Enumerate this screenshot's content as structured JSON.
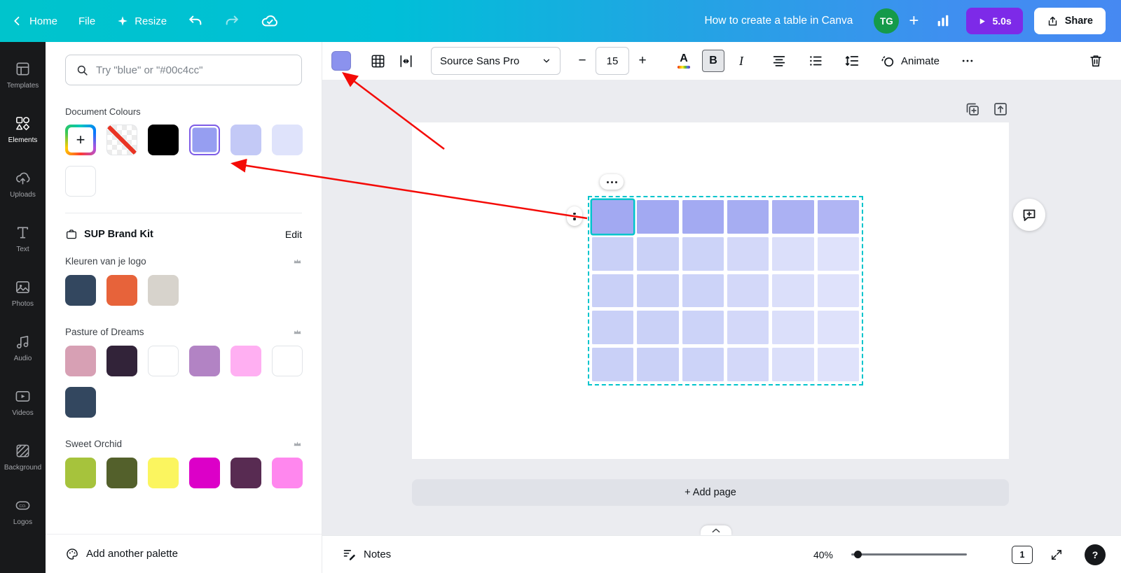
{
  "topbar": {
    "home_label": "Home",
    "file_label": "File",
    "resize_label": "Resize",
    "title": "How to create a table in Canva",
    "avatar_initials": "TG",
    "play_duration": "5.0s",
    "share_label": "Share",
    "play_color": "#7d2ae8",
    "avatar_color": "#159a4a"
  },
  "sidebar": {
    "items": [
      {
        "label": "Templates"
      },
      {
        "label": "Elements"
      },
      {
        "label": "Uploads"
      },
      {
        "label": "Text"
      },
      {
        "label": "Photos"
      },
      {
        "label": "Audio"
      },
      {
        "label": "Videos"
      },
      {
        "label": "Background"
      },
      {
        "label": "Logos"
      }
    ]
  },
  "panel": {
    "search_placeholder": "Try \"blue\" or \"#00c4cc\"",
    "document_colours_title": "Document Colours",
    "document_swatches": [
      {
        "type": "add"
      },
      {
        "type": "transparent"
      },
      {
        "type": "solid",
        "color": "#000000"
      },
      {
        "type": "solid",
        "color": "#969ef1",
        "selected": true
      },
      {
        "type": "solid",
        "color": "#c3c9f6"
      },
      {
        "type": "solid",
        "color": "#dfe3fb"
      },
      {
        "type": "solid",
        "color": "#ffffff"
      }
    ],
    "brand_kit_title": "SUP Brand Kit",
    "brand_kit_edit": "Edit",
    "palettes": [
      {
        "name": "Kleuren van je logo",
        "colors": [
          "#33475f",
          "#e7633a",
          "#d7d3cc"
        ]
      },
      {
        "name": "Pasture of Dreams",
        "colors": [
          "#d7a0b4",
          "#322339",
          "#ffffff",
          "#b283c4",
          "#ffaff2",
          "#ffffff",
          "#33475f"
        ]
      },
      {
        "name": "Sweet Orchid",
        "colors": [
          "#a6c33c",
          "#53602b",
          "#fbf55f",
          "#dc00c8",
          "#582b52",
          "#ff87ee"
        ]
      }
    ],
    "add_palette_label": "Add another palette"
  },
  "toolbar": {
    "table_fill_color": "#8b92ee",
    "font_name": "Source Sans Pro",
    "minus_label": "−",
    "font_size": "15",
    "plus_label": "+",
    "text_color_label": "A",
    "bold_label": "B",
    "italic_label": "I",
    "animate_label": "Animate"
  },
  "canvas": {
    "table": {
      "rows": 5,
      "cols": 6,
      "header_colors": [
        "#a2a9f2",
        "#a2a9f2",
        "#a3aaf2",
        "#a6adf2",
        "#abb1f3",
        "#b0b5f4"
      ],
      "body_colors": [
        "#c9d0f7",
        "#cad1f7",
        "#ccd3f8",
        "#d3d8f9",
        "#dbdffa",
        "#dfe2fb"
      ],
      "selection_color": "#00c4cc"
    },
    "add_page_label": "+ Add page"
  },
  "statusbar": {
    "notes_label": "Notes",
    "zoom_value": "40%",
    "page_number": "1"
  },
  "annotations": {
    "color": "#f40b07"
  }
}
